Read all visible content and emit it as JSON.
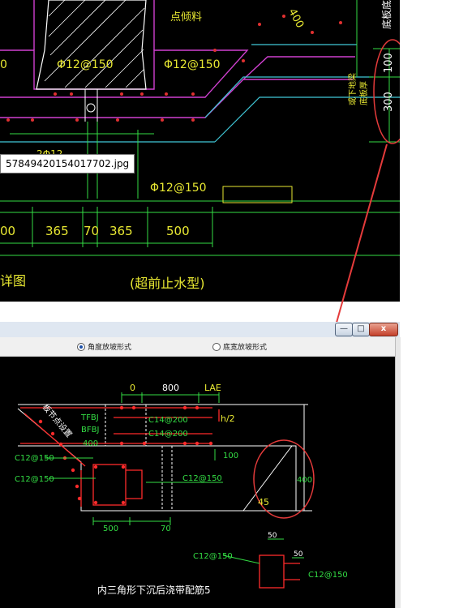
{
  "top_drawing": {
    "labels": {
      "pour_point": "点倾料",
      "dim_400_slant": "400",
      "side_label": "底板底",
      "rebar_left_partial": "0",
      "rebar_a": "Φ12@150",
      "rebar_b": "Φ12@150",
      "rebar_c": "2Φ12",
      "rebar_d": "Φ12@150",
      "vdim_100": "100",
      "vdim_300": "300",
      "side_note_1": "底板厚",
      "side_note_2": "或下地梁",
      "dims": [
        "00",
        "365",
        "70",
        "365",
        "500"
      ],
      "caption_left": "详图",
      "caption_right": "(超前止水型)"
    },
    "tooltip": "57849420154017702.jpg"
  },
  "window": {
    "buttons": {
      "minimize": "—",
      "maximize": "□",
      "close": "x"
    },
    "radios": [
      {
        "label": "角度放坡形式",
        "selected": true
      },
      {
        "label": "底宽放坡形式",
        "selected": false
      }
    ],
    "drawing": {
      "dim_top": [
        "0",
        "800",
        "LAE"
      ],
      "tfbj": "TFBJ",
      "bfbj": "BFBJ",
      "t400": "400",
      "c14_top": "C14@200",
      "c14_bot": "C14@200",
      "h2": "h/2",
      "node_label": "板节点设置",
      "c12_a": "C12@150",
      "c12_b": "C12@150",
      "c12_c": "C12@150",
      "r100": "100",
      "r400": "400",
      "r45": "45",
      "b500": "500",
      "b70": "70",
      "d50a": "50",
      "d50b": "50",
      "c12_d": "C12@150",
      "c12_e": "C12@150",
      "caption": "内三角形下沉后浇带配筋5"
    }
  },
  "colors": {
    "cad_bg": "#000000",
    "green": "#33dd44",
    "yellow": "#e8e832",
    "magenta": "#d040d0",
    "cyan": "#40c8d8",
    "red": "#ff2b2b",
    "white": "#ffffff"
  }
}
